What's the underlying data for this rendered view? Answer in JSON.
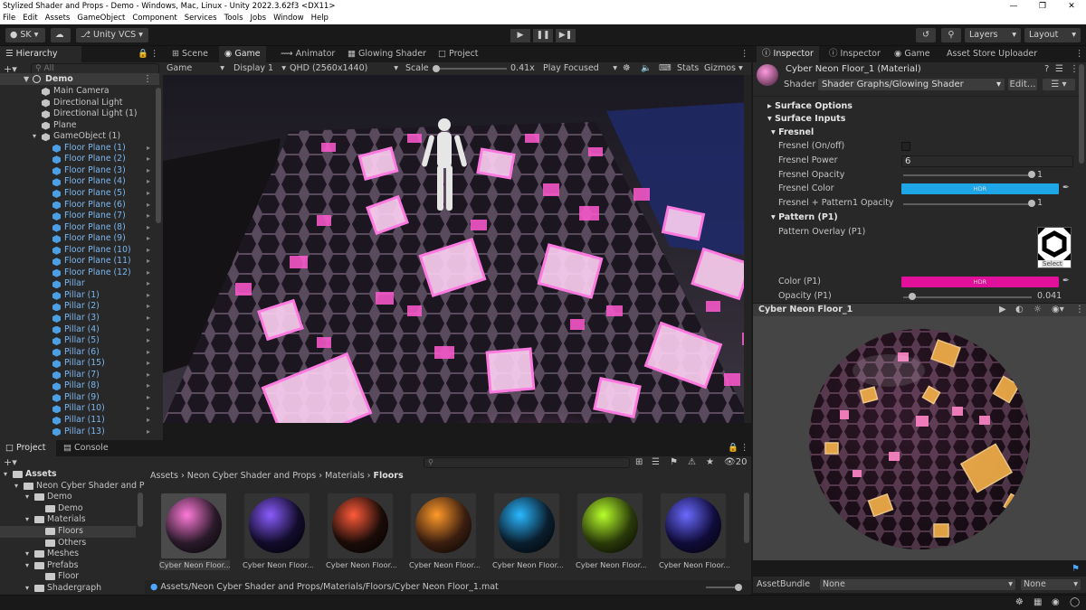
{
  "window": {
    "title": "Stylized Shader and Props - Demo - Windows, Mac, Linux - Unity 2022.3.62f3 <DX11>"
  },
  "menu": [
    "File",
    "Edit",
    "Assets",
    "GameObject",
    "Component",
    "Services",
    "Tools",
    "Jobs",
    "Window",
    "Help"
  ],
  "toolbar": {
    "account": "SK",
    "vcs": "Unity VCS",
    "layers": "Layers",
    "layout": "Layout"
  },
  "hierarchy": {
    "tab": "Hierarchy",
    "search_placeholder": "All",
    "scene": "Demo",
    "items": [
      {
        "label": "Main Camera",
        "depth": 1,
        "blue": false,
        "arrow": false
      },
      {
        "label": "Directional Light",
        "depth": 1,
        "blue": false,
        "arrow": false
      },
      {
        "label": "Directional Light (1)",
        "depth": 1,
        "blue": false,
        "arrow": false
      },
      {
        "label": "Plane",
        "depth": 1,
        "blue": false,
        "arrow": false
      },
      {
        "label": "GameObject (1)",
        "depth": 1,
        "blue": false,
        "arrow": false,
        "expanded": true
      },
      {
        "label": "Floor Plane (1)",
        "depth": 2,
        "blue": true,
        "arrow": true
      },
      {
        "label": "Floor Plane (2)",
        "depth": 2,
        "blue": true,
        "arrow": true
      },
      {
        "label": "Floor Plane (3)",
        "depth": 2,
        "blue": true,
        "arrow": true
      },
      {
        "label": "Floor Plane (4)",
        "depth": 2,
        "blue": true,
        "arrow": true
      },
      {
        "label": "Floor Plane (5)",
        "depth": 2,
        "blue": true,
        "arrow": true
      },
      {
        "label": "Floor Plane (6)",
        "depth": 2,
        "blue": true,
        "arrow": true
      },
      {
        "label": "Floor Plane (7)",
        "depth": 2,
        "blue": true,
        "arrow": true
      },
      {
        "label": "Floor Plane (8)",
        "depth": 2,
        "blue": true,
        "arrow": true
      },
      {
        "label": "Floor Plane (9)",
        "depth": 2,
        "blue": true,
        "arrow": true
      },
      {
        "label": "Floor Plane (10)",
        "depth": 2,
        "blue": true,
        "arrow": true
      },
      {
        "label": "Floor Plane (11)",
        "depth": 2,
        "blue": true,
        "arrow": true
      },
      {
        "label": "Floor Plane (12)",
        "depth": 2,
        "blue": true,
        "arrow": true
      },
      {
        "label": "Pillar",
        "depth": 2,
        "blue": true,
        "arrow": true
      },
      {
        "label": "Pillar (1)",
        "depth": 2,
        "blue": true,
        "arrow": true
      },
      {
        "label": "Pillar (2)",
        "depth": 2,
        "blue": true,
        "arrow": true
      },
      {
        "label": "Pillar (3)",
        "depth": 2,
        "blue": true,
        "arrow": true
      },
      {
        "label": "Pillar (4)",
        "depth": 2,
        "blue": true,
        "arrow": true
      },
      {
        "label": "Pillar (5)",
        "depth": 2,
        "blue": true,
        "arrow": true
      },
      {
        "label": "Pillar (6)",
        "depth": 2,
        "blue": true,
        "arrow": true
      },
      {
        "label": "Pillar (15)",
        "depth": 2,
        "blue": true,
        "arrow": true
      },
      {
        "label": "Pillar (7)",
        "depth": 2,
        "blue": true,
        "arrow": true
      },
      {
        "label": "Pillar (8)",
        "depth": 2,
        "blue": true,
        "arrow": true
      },
      {
        "label": "Pillar (9)",
        "depth": 2,
        "blue": true,
        "arrow": true
      },
      {
        "label": "Pillar (10)",
        "depth": 2,
        "blue": true,
        "arrow": true
      },
      {
        "label": "Pillar (11)",
        "depth": 2,
        "blue": true,
        "arrow": true
      },
      {
        "label": "Pillar (13)",
        "depth": 2,
        "blue": true,
        "arrow": true
      }
    ]
  },
  "center_tabs": [
    "Scene",
    "Game",
    "Animator",
    "Glowing Shader",
    "Project"
  ],
  "game_bar": {
    "mode": "Game",
    "display": "Display 1",
    "resolution": "QHD (2560x1440)",
    "scale_label": "Scale",
    "scale_value": "0.41x",
    "play_focused": "Play Focused",
    "stats": "Stats",
    "gizmos": "Gizmos"
  },
  "right_tabs": [
    "Inspector",
    "Inspector",
    "Game",
    "Asset Store Uploader"
  ],
  "inspector": {
    "material": "Cyber Neon Floor_1 (Material)",
    "shader_label": "Shader",
    "shader_value": "Shader Graphs/Glowing Shader",
    "edit_button": "Edit...",
    "surface_options": "Surface Options",
    "surface_inputs": "Surface Inputs",
    "fresnel_header": "Fresnel",
    "fresnel_onoff": "Fresnel (On/off)",
    "fresnel_power_label": "Fresnel Power",
    "fresnel_power": "6",
    "fresnel_opacity_label": "Fresnel Opacity",
    "fresnel_opacity": "1",
    "fresnel_opacity_level": 1,
    "fresnel_color_label": "Fresnel Color",
    "fresnel_color": "#1fa6e6",
    "hdr": "HDR",
    "fp_opacity_label": "Fresnel + Pattern1 Opacity",
    "fp_opacity": "1",
    "fp_opacity_level": 1,
    "pattern_header": "Pattern (P1)",
    "pattern_overlay_label": "Pattern Overlay (P1)",
    "select": "Select",
    "color_p1_label": "Color (P1)",
    "color_p1": "#e0109a",
    "opacity_p1_label": "Opacity (P1)",
    "opacity_p1": "0.041",
    "opacity_p1_level": 0.041
  },
  "preview": {
    "title": "Cyber Neon Floor_1"
  },
  "asset_bundle": {
    "label": "AssetBundle",
    "value": "None",
    "variant": "None"
  },
  "bottom_tabs": [
    "Project",
    "Console"
  ],
  "project_tree": [
    {
      "label": "Assets",
      "depth": 0,
      "bold": true
    },
    {
      "label": "Neon Cyber Shader and P",
      "depth": 1
    },
    {
      "label": "Demo",
      "depth": 2
    },
    {
      "label": "Demo",
      "depth": 3
    },
    {
      "label": "Materials",
      "depth": 2
    },
    {
      "label": "Floors",
      "depth": 3,
      "selected": true
    },
    {
      "label": "Others",
      "depth": 3
    },
    {
      "label": "Meshes",
      "depth": 2
    },
    {
      "label": "Prefabs",
      "depth": 2
    },
    {
      "label": "Floor",
      "depth": 3
    },
    {
      "label": "Shadergraph",
      "depth": 2
    }
  ],
  "breadcrumb": [
    "Assets",
    "Neon Cyber Shader and Props",
    "Materials",
    "Floors"
  ],
  "visible_count": "20",
  "assets": [
    {
      "label": "Cyber Neon Floor...",
      "color": "#ff7ad9",
      "bg": "#2a1a2a",
      "selected": true
    },
    {
      "label": "Cyber Neon Floor...",
      "color": "#8a5cff",
      "bg": "#120c2a"
    },
    {
      "label": "Cyber Neon Floor...",
      "color": "#ff5a3a",
      "bg": "#1a0c08"
    },
    {
      "label": "Cyber Neon Floor...",
      "color": "#ff9a2a",
      "bg": "#3a1e10"
    },
    {
      "label": "Cyber Neon Floor...",
      "color": "#2ab8ff",
      "bg": "#0a1e2e"
    },
    {
      "label": "Cyber Neon Floor...",
      "color": "#b8ff2a",
      "bg": "#2a3a0a"
    },
    {
      "label": "Cyber Neon Floor...",
      "color": "#6a6aff",
      "bg": "#100c3a"
    }
  ],
  "path": "Assets/Neon Cyber Shader and Props/Materials/Floors/Cyber Neon Floor_1.mat"
}
